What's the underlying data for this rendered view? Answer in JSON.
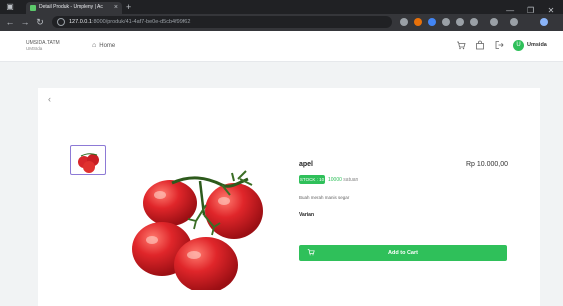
{
  "browser": {
    "tab_title": "Detail Produk - Umpleny | Ac",
    "tab_close": "×",
    "new_tab": "+",
    "url_host": "127.0.0.1",
    "url_path": ":8000/produk/41-4af7-be0e-d5cb4f99f62",
    "window_controls": [
      "—",
      "❐",
      "✕"
    ]
  },
  "header": {
    "brand_name": "UMSIDA.TATM",
    "brand_sub": "UMSIda",
    "nav_home": "Home",
    "user": {
      "initial": "U",
      "name": "Umsida"
    }
  },
  "product": {
    "back": "‹",
    "name": "apel",
    "price": "Rp 10.000,00",
    "stock_badge": "STOCK : 10",
    "stock_count": "10000",
    "stock_unit": "satuan",
    "description": "Buah merah manis segar",
    "variant_label": "Varian",
    "add_to_cart": "Add to Cart"
  },
  "colors": {
    "accent_green": "#2fc05a",
    "thumb_border": "#8d7ad6",
    "tomato_red": "#d8262b"
  },
  "icons": {
    "home": "house-icon",
    "cart": "cart-icon",
    "bag": "bag-icon",
    "logout": "logout-icon"
  }
}
